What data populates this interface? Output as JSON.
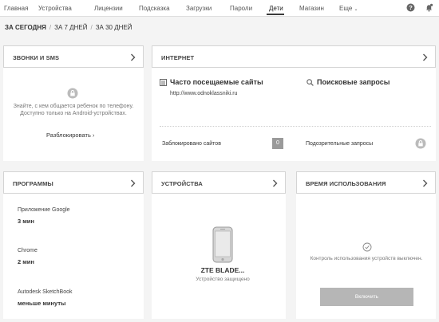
{
  "nav": {
    "items": [
      "Главная",
      "Устройства",
      "Лицензии",
      "Подсказка",
      "Загрузки",
      "Пароли",
      "Дети",
      "Магазин",
      "Еще"
    ],
    "active": "Дети",
    "icons": [
      "help-icon",
      "notification-bell-icon"
    ]
  },
  "filters": {
    "today": "ЗА СЕГОДНЯ",
    "sep": "/",
    "week": "ЗА 7 ДНЕЙ",
    "month": "ЗА 30 ДНЕЙ"
  },
  "calls": {
    "title": "ЗВОНКИ И SMS",
    "description": "Знайте, с кем общается ребенок по телефону. Доступно только на Android-устройствах.",
    "link": "Разблокировать"
  },
  "internet": {
    "title": "ИНТЕРНЕТ",
    "frequent_title": "Часто посещаемые сайты",
    "frequent_site": "http://www.odnoklassniki.ru",
    "search_title": "Поисковые запросы",
    "blocked_label": "Заблокировано сайтов",
    "blocked_count": "0",
    "suspicious_label": "Подозрительные запросы"
  },
  "programs": {
    "title": "ПРОГРАММЫ",
    "items": [
      {
        "name": "Приложение Google",
        "time": "3 мин"
      },
      {
        "name": "Chrome",
        "time": "2 мин"
      },
      {
        "name": "Autodesk SketchBook",
        "time": "меньше минуты"
      }
    ]
  },
  "devices": {
    "title": "УСТРОЙСТВА",
    "device_name": "ZTE BLADE...",
    "status": "Устройство защищено"
  },
  "usage": {
    "title": "ВРЕМЯ ИСПОЛЬЗОВАНИЯ",
    "description": "Контроль использования устройств выключен.",
    "button": "Включить"
  },
  "colors": {
    "page_bg": "#f4f4f4",
    "card_bg": "#ffffff",
    "border": "#d4d4d4",
    "button": "#b6b6b6",
    "active_nav": "#3a3a3a"
  }
}
